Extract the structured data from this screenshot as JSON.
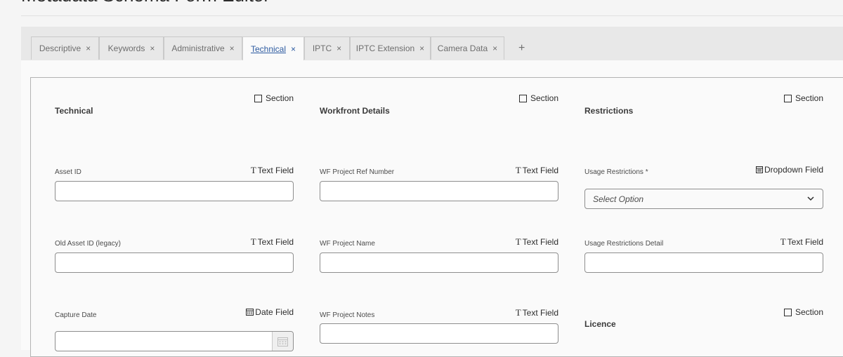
{
  "page": {
    "title": "Metadata Schema Form Editor"
  },
  "tabs": [
    {
      "label": "Descriptive",
      "close": "×"
    },
    {
      "label": "Keywords",
      "close": "×"
    },
    {
      "label": "Administrative",
      "close": "×"
    },
    {
      "label": "Technical",
      "close": "×",
      "active": true
    },
    {
      "label": "IPTC",
      "close": "×"
    },
    {
      "label": "IPTC Extension",
      "close": "×"
    },
    {
      "label": "Camera Data",
      "close": "×"
    }
  ],
  "add_tab": "+",
  "columns": [
    {
      "section": {
        "title": "Technical",
        "tag": "Section"
      },
      "fields": [
        {
          "label": "Asset ID",
          "tag": "Text Field",
          "tag_glyph": "T",
          "value": ""
        },
        {
          "label": "Old Asset ID (legacy)",
          "tag": "Text Field",
          "tag_glyph": "T",
          "value": ""
        },
        {
          "label": "Capture Date",
          "tag": "Date Field",
          "value": ""
        }
      ]
    },
    {
      "section": {
        "title": "Workfront Details",
        "tag": "Section"
      },
      "fields": [
        {
          "label": "WF Project Ref Number",
          "tag": "Text Field",
          "tag_glyph": "T",
          "value": ""
        },
        {
          "label": "WF Project Name",
          "tag": "Text Field",
          "tag_glyph": "T",
          "value": ""
        },
        {
          "label": "WF Project Notes",
          "tag": "Text Field",
          "tag_glyph": "T",
          "value": ""
        }
      ]
    },
    {
      "section": {
        "title": "Restrictions",
        "tag": "Section"
      },
      "fields": [
        {
          "label": "Usage Restrictions *",
          "tag": "Dropdown Field",
          "placeholder": "Select Option"
        },
        {
          "label": "Usage Restrictions Detail",
          "tag": "Text Field",
          "tag_glyph": "T",
          "value": ""
        }
      ],
      "section2": {
        "title": "Licence",
        "tag": "Section"
      }
    }
  ],
  "icons": {
    "checkbox": "checkbox-icon",
    "text_field": "text-field-icon",
    "date_field": "calendar-icon",
    "dropdown_field": "dropdown-field-icon",
    "chevron": "chevron-down-icon"
  }
}
